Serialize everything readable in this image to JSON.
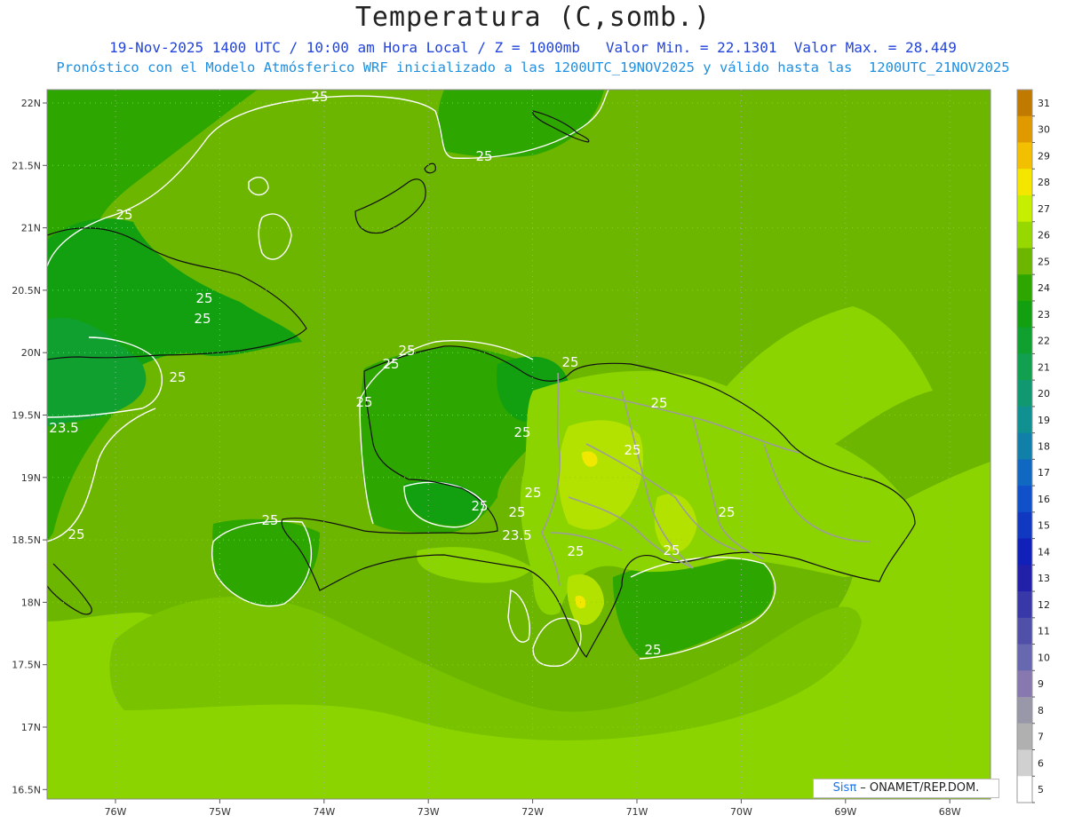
{
  "title": "Temperatura (C,somb.)",
  "subtitle_line1": "19-Nov-2025 1400 UTC / 10:00 am Hora Local / Z = 1000mb   Valor Min. = 22.1301  Valor Max. = 28.449",
  "subtitle_line2": "Pronóstico con el Modelo Atmósferico WRF inicializado a las 1200UTC_19NOV2025 y válido hasta las  1200UTC_21NOV2025",
  "lat_labels": [
    "22N",
    "21.5N",
    "21N",
    "20.5N",
    "20N",
    "19.5N",
    "19N",
    "18.5N",
    "18N",
    "17.5N",
    "17N",
    "16.5N"
  ],
  "lon_labels": [
    "76W",
    "75W",
    "74W",
    "73W",
    "72W",
    "71W",
    "70W",
    "69W",
    "68W"
  ],
  "colorbar": {
    "levels": [
      "31",
      "30",
      "29",
      "28",
      "27",
      "26",
      "25",
      "24",
      "23",
      "22",
      "21",
      "20",
      "19",
      "18",
      "17",
      "16",
      "15",
      "14",
      "13",
      "12",
      "11",
      "10",
      "9",
      "8",
      "7",
      "6",
      "5"
    ],
    "colors": [
      "#c07a00",
      "#e09a00",
      "#f2c000",
      "#f5e600",
      "#c6ee00",
      "#96d800",
      "#6cb600",
      "#2ea600",
      "#12a010",
      "#10a030",
      "#10a050",
      "#109870",
      "#109090",
      "#1080a8",
      "#1068c0",
      "#1050c8",
      "#1038c0",
      "#1020b8",
      "#2020a8",
      "#3838a8",
      "#5050a8",
      "#6868b0",
      "#8878b0",
      "#9898a8",
      "#b0b0b0",
      "#d0d0d0",
      "#ffffff"
    ]
  },
  "contour_labels": [
    "25",
    "25",
    "25",
    "25",
    "25",
    "25",
    "23.5",
    "25",
    "25",
    "25",
    "25",
    "25",
    "25",
    "25",
    "25",
    "23.5",
    "25",
    "25",
    "25",
    "25",
    "25",
    "25",
    "25",
    "25"
  ],
  "credit": {
    "brand": "Sis",
    "pi": "π",
    "text": "– ONAMET/REP.DOM."
  }
}
